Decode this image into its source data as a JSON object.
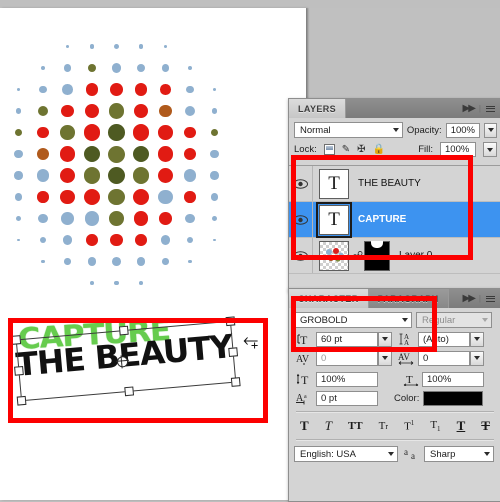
{
  "app": {
    "name": "Adobe Photoshop",
    "accent_selection": "#3d93f0",
    "annotation_color": "#fc0000",
    "panel_bg": "#d4d4d4"
  },
  "canvas": {
    "artwork_label": "halftone-tomato-collage",
    "text_art": {
      "line1": "CAPTURE",
      "line1_color": "#66cc4e",
      "line2": "THE BEAUTY",
      "line2_color": "#111111"
    },
    "transform_cursor": "rotate-cursor"
  },
  "layers_panel": {
    "tab_label": "LAYERS",
    "blend_mode": "Normal",
    "opacity_label": "Opacity:",
    "opacity_value": "100%",
    "lock_label": "Lock:",
    "fill_label": "Fill:",
    "fill_value": "100%",
    "rows": [
      {
        "name": "THE BEAUTY",
        "thumb": "T",
        "type": "text",
        "selected": false,
        "visible": true
      },
      {
        "name": "CAPTURE",
        "thumb": "T",
        "type": "text",
        "selected": true,
        "visible": true
      },
      {
        "name": "Layer 0",
        "thumb": "",
        "type": "image-with-mask",
        "selected": false,
        "visible": true
      }
    ]
  },
  "character_panel": {
    "tab_character": "CHARACTER",
    "tab_paragraph": "PARAGRAPH",
    "font_family": "GROBOLD",
    "font_style": "Regular",
    "font_size": "60 pt",
    "leading": "(Auto)",
    "kerning": "0",
    "tracking": "0",
    "vertical_scale": "100%",
    "horizontal_scale": "100%",
    "baseline_shift": "0 pt",
    "color_label": "Color:",
    "color_value": "#000000",
    "style_buttons": [
      "T",
      "T",
      "TT",
      "Tr",
      "T¹",
      "T₁",
      "T",
      "T"
    ],
    "language": "English: USA",
    "antialias": "Sharp"
  },
  "icons": {
    "eye": "eye-icon",
    "chevron_down": "chevron-down-icon",
    "double_arrow": "double-chevron-right-icon",
    "panel_menu": "panel-menu-icon",
    "link": "link-icon",
    "lock": "lock-icon",
    "font_size": "font-size-icon",
    "leading": "leading-icon",
    "kerning": "kerning-icon",
    "tracking": "tracking-icon",
    "vertical_scale": "vertical-scale-icon",
    "horizontal_scale": "horizontal-scale-icon",
    "baseline": "baseline-shift-icon",
    "antialias": "antialias-icon"
  }
}
